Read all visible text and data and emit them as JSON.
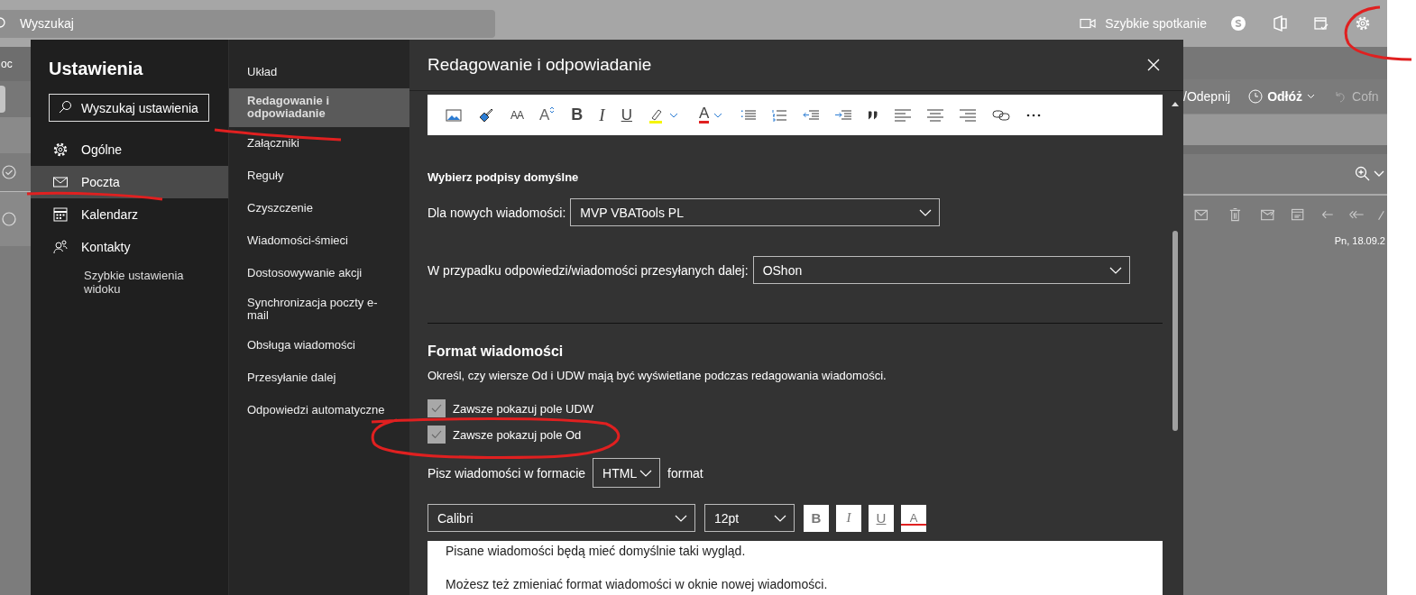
{
  "app_bar": {
    "search_placeholder": "Wyszukaj",
    "meet_now": "Szybkie spotkanie"
  },
  "background": {
    "left_label": "oc",
    "actions": [
      {
        "kind": "pin",
        "label": "/Odepnij"
      },
      {
        "kind": "snooze",
        "label": "Odłóż"
      },
      {
        "kind": "undo",
        "label": "Cofn"
      }
    ],
    "date": "Pn, 18.09.2"
  },
  "settings": {
    "title": "Ustawienia",
    "search_placeholder": "Wyszukaj ustawienia",
    "categories": [
      {
        "label": "Ogólne",
        "selected": false
      },
      {
        "label": "Poczta",
        "selected": true
      },
      {
        "label": "Kalendarz",
        "selected": false
      },
      {
        "label": "Kontakty",
        "selected": false
      }
    ],
    "quick_settings": "Szybkie ustawienia widoku"
  },
  "mail_sections": [
    {
      "label": "Układ",
      "selected": false
    },
    {
      "label": "Redagowanie i odpowiadanie",
      "selected": true
    },
    {
      "label": "Załączniki",
      "selected": false
    },
    {
      "label": "Reguły",
      "selected": false
    },
    {
      "label": "Czyszczenie",
      "selected": false
    },
    {
      "label": "Wiadomości-śmieci",
      "selected": false
    },
    {
      "label": "Dostosowywanie akcji",
      "selected": false
    },
    {
      "label": "Synchronizacja poczty e-mail",
      "selected": false
    },
    {
      "label": "Obsługa wiadomości",
      "selected": false
    },
    {
      "label": "Przesyłanie dalej",
      "selected": false
    },
    {
      "label": "Odpowiedzi automatyczne",
      "selected": false
    }
  ],
  "panel": {
    "title": "Redagowanie i odpowiadanie",
    "toolbar": [
      {
        "kind": "image"
      },
      {
        "kind": "painter"
      },
      {
        "kind": "font-size",
        "glyph": "AA"
      },
      {
        "kind": "grow-font",
        "glyph": "A"
      },
      {
        "kind": "bold",
        "glyph": "B"
      },
      {
        "kind": "italic",
        "glyph": "I"
      },
      {
        "kind": "underline",
        "glyph": "U"
      },
      {
        "kind": "highlight"
      },
      {
        "kind": "font-color",
        "glyph": "A"
      },
      {
        "kind": "bullets"
      },
      {
        "kind": "numbering"
      },
      {
        "kind": "outdent"
      },
      {
        "kind": "indent"
      },
      {
        "kind": "quote"
      },
      {
        "kind": "align-left"
      },
      {
        "kind": "align-center"
      },
      {
        "kind": "align-right"
      },
      {
        "kind": "link"
      },
      {
        "kind": "more"
      }
    ],
    "signatures": {
      "heading": "Wybierz podpisy domyślne",
      "new_label": "Dla nowych wiadomości:",
      "new_value": "MVP VBATools PL",
      "reply_label": "W przypadku odpowiedzi/wiadomości przesyłanych dalej:",
      "reply_value": "OShon"
    },
    "message_format": {
      "heading": "Format wiadomości",
      "description": "Określ, czy wiersze Od i UDW mają być wyświetlane podczas redagowania wiadomości.",
      "options": [
        {
          "label": "Zawsze pokazuj pole UDW",
          "checked": true
        },
        {
          "label": "Zawsze pokazuj pole Od",
          "checked": true
        }
      ],
      "compose_label": "Pisz wiadomości w formacie",
      "compose_value": "HTML",
      "compose_suffix": "format",
      "font": "Calibri",
      "size": "12pt",
      "style_buttons": [
        {
          "kind": "bold",
          "glyph": "B"
        },
        {
          "kind": "italic",
          "glyph": "I"
        },
        {
          "kind": "underline",
          "glyph": "U"
        },
        {
          "kind": "font-color",
          "glyph": "A"
        }
      ],
      "preview": [
        "Pisane wiadomości będą mieć domyślnie taki wygląd.",
        "Możesz też zmieniać format wiadomości w oknie nowej wiadomości."
      ]
    }
  }
}
